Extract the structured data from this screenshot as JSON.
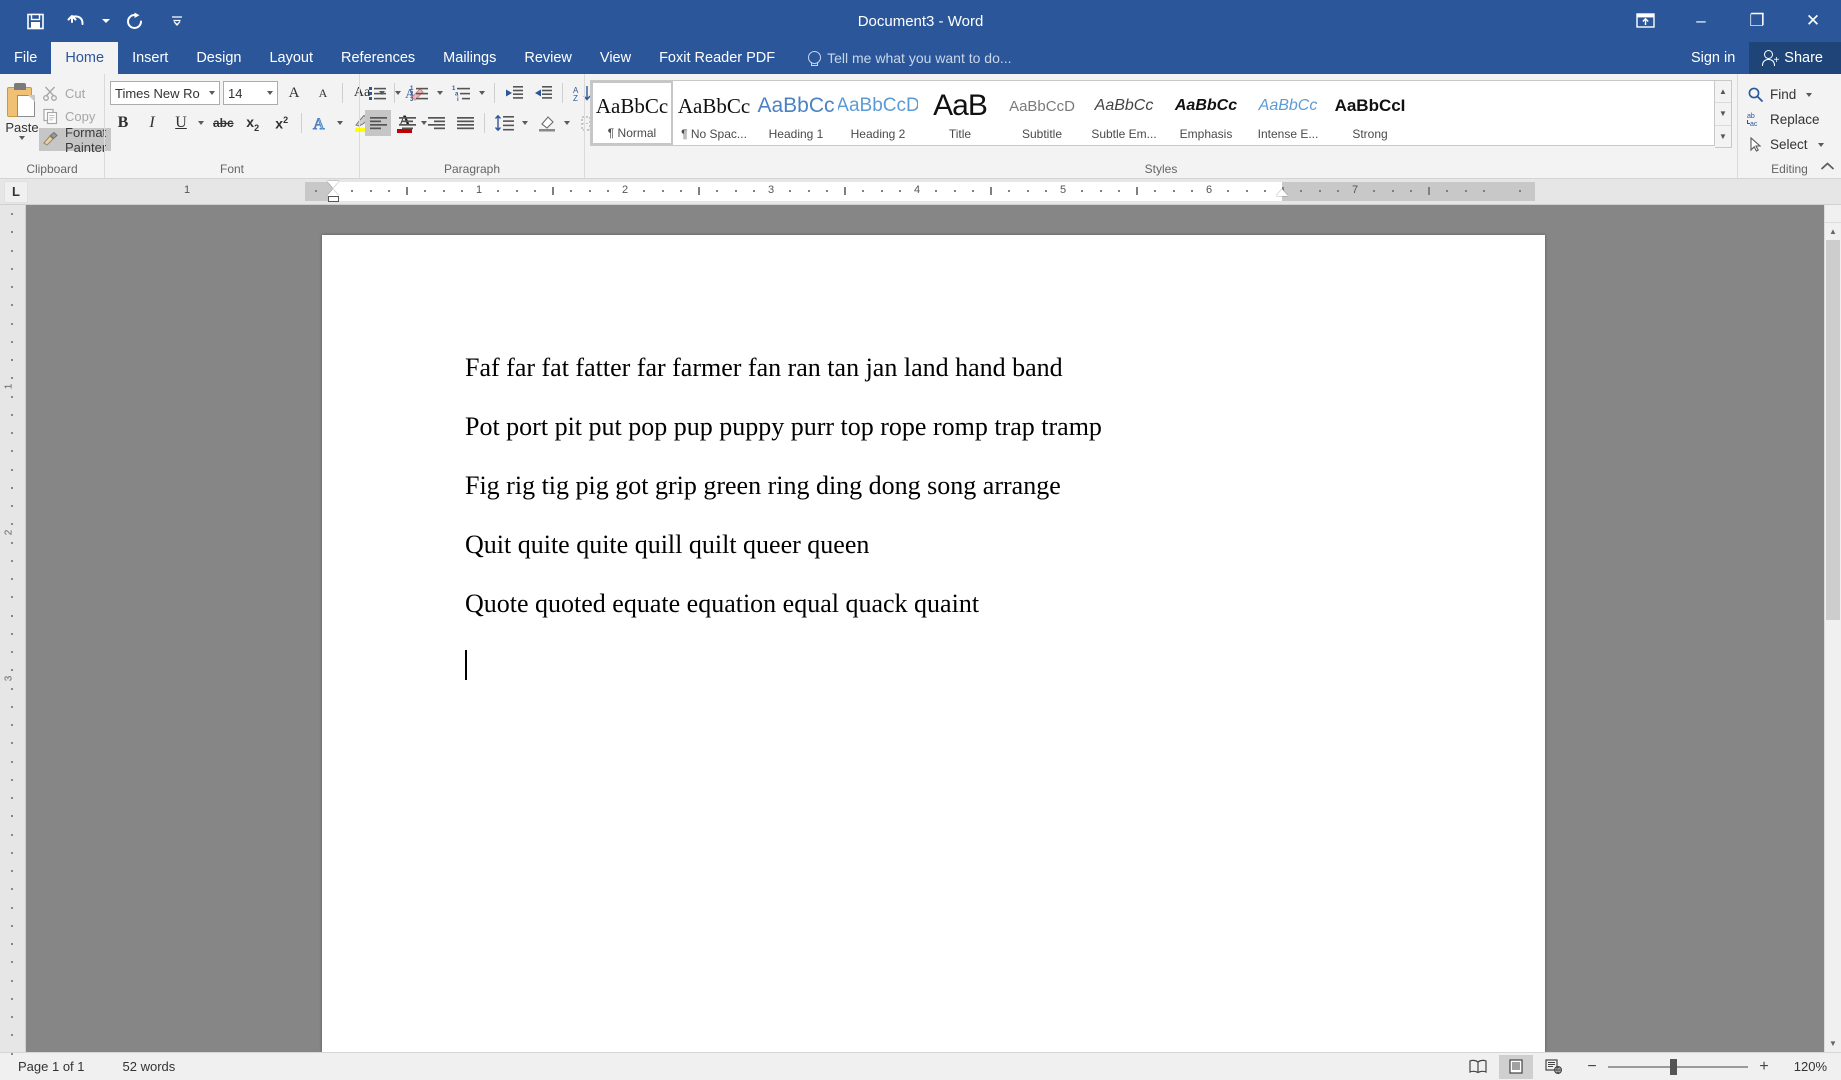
{
  "titlebar": {
    "document_title": "Document3 - Word",
    "quick_access": [
      {
        "name": "save",
        "icon": "save-icon"
      },
      {
        "name": "undo",
        "icon": "undo-icon"
      },
      {
        "name": "redo",
        "icon": "redo-icon"
      },
      {
        "name": "customize",
        "icon": "customize-qat-icon"
      }
    ],
    "ribbon_display_options": "ribbon-display-icon",
    "minimize": "–",
    "restore": "❐",
    "close": "✕"
  },
  "tabs": [
    {
      "label": "File",
      "active": false
    },
    {
      "label": "Home",
      "active": true
    },
    {
      "label": "Insert",
      "active": false
    },
    {
      "label": "Design",
      "active": false
    },
    {
      "label": "Layout",
      "active": false
    },
    {
      "label": "References",
      "active": false
    },
    {
      "label": "Mailings",
      "active": false
    },
    {
      "label": "Review",
      "active": false
    },
    {
      "label": "View",
      "active": false
    },
    {
      "label": "Foxit Reader PDF",
      "active": false
    }
  ],
  "tellme": {
    "placeholder": "Tell me what you want to do..."
  },
  "account": {
    "signin": "Sign in",
    "share": "Share"
  },
  "ribbon": {
    "clipboard": {
      "label": "Clipboard",
      "paste": "Paste",
      "cut": "Cut",
      "copy": "Copy",
      "format_painter": "Format Painter"
    },
    "font": {
      "label": "Font",
      "font_name": "Times New Ro",
      "font_size": "14",
      "grow_font": "A",
      "shrink_font": "A",
      "change_case": "Aa",
      "clear_formatting": "clear-formatting-icon",
      "bold": "B",
      "italic": "I",
      "underline": "U",
      "strikethrough": "abc",
      "subscript": "x",
      "superscript": "x",
      "text_effects": "A",
      "highlight": "text-highlight-icon",
      "font_color": "A",
      "highlight_color": "#ffff00",
      "font_color_value": "#c00000"
    },
    "paragraph": {
      "label": "Paragraph",
      "bullets": "bullets-icon",
      "numbering": "numbering-icon",
      "multilevel": "multilevel-list-icon",
      "decrease_indent": "decrease-indent-icon",
      "increase_indent": "increase-indent-icon",
      "sort": "sort-icon",
      "show_marks": "¶",
      "align_left": "align-left-icon",
      "align_center": "align-center-icon",
      "align_right": "align-right-icon",
      "justify": "justify-icon",
      "line_spacing": "line-spacing-icon",
      "shading": "shading-icon",
      "borders": "borders-icon"
    },
    "styles": {
      "label": "Styles",
      "items": [
        {
          "preview": "AaBbCc",
          "name": "¶ Normal",
          "cls": "sp-normal",
          "selected": true
        },
        {
          "preview": "AaBbCc",
          "name": "¶ No Spac...",
          "cls": "sp-nospace",
          "selected": false
        },
        {
          "preview": "AaBbCc",
          "name": "Heading 1",
          "cls": "sp-h1",
          "selected": false
        },
        {
          "preview": "AaBbCcD",
          "name": "Heading 2",
          "cls": "sp-h2",
          "selected": false
        },
        {
          "preview": "AaB",
          "name": "Title",
          "cls": "sp-title",
          "selected": false
        },
        {
          "preview": "AaBbCcD",
          "name": "Subtitle",
          "cls": "sp-subtitle",
          "selected": false
        },
        {
          "preview": "AaBbCc",
          "name": "Subtle Em...",
          "cls": "sp-subem",
          "selected": false
        },
        {
          "preview": "AaBbCc",
          "name": "Emphasis",
          "cls": "sp-em",
          "selected": false
        },
        {
          "preview": "AaBbCc",
          "name": "Intense E...",
          "cls": "sp-intense",
          "selected": false
        },
        {
          "preview": "AaBbCcI",
          "name": "Strong",
          "cls": "sp-strong",
          "selected": false
        }
      ]
    },
    "editing": {
      "label": "Editing",
      "find": "Find",
      "replace": "Replace",
      "select": "Select"
    }
  },
  "ruler": {
    "tab_selector": "L",
    "numbers": [
      "1",
      "2",
      "3",
      "4",
      "5",
      "6",
      "7"
    ],
    "vertical_numbers": [
      "1",
      "2",
      "3"
    ]
  },
  "document": {
    "lines": [
      "Faf far fat fatter far farmer fan ran tan jan land hand band",
      "Pot port pit put pop pup puppy purr top rope romp trap tramp",
      "Fig rig tig pig got grip green ring ding dong song arrange",
      "Quit quite quite quill quilt queer queen",
      "Quote quoted equate equation equal quack quaint"
    ]
  },
  "statusbar": {
    "page": "Page 1 of 1",
    "words": "52 words",
    "views": [
      {
        "name": "read-mode",
        "icon": "read-mode-icon",
        "active": false
      },
      {
        "name": "print-layout",
        "icon": "print-layout-icon",
        "active": true
      },
      {
        "name": "web-layout",
        "icon": "web-layout-icon",
        "active": false
      }
    ],
    "zoom_out": "−",
    "zoom_in": "+",
    "zoom_level": "120%"
  },
  "colors": {
    "word_blue": "#2b579a",
    "ribbon_bg": "#f3f3f3",
    "page_bg": "#868686"
  }
}
